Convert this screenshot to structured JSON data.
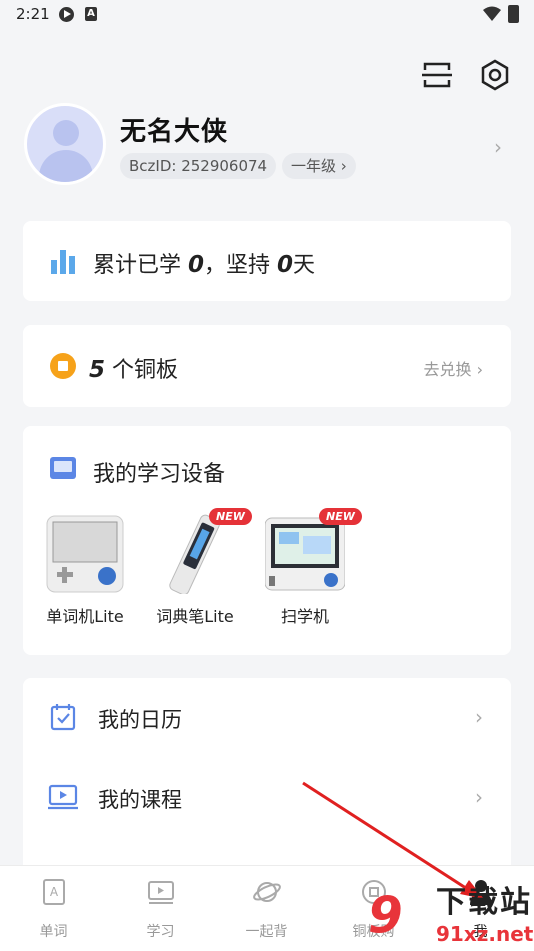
{
  "status_bar": {
    "time": "2:21",
    "icon2": "A",
    "wifi": "wifi-icon",
    "battery": "battery-icon"
  },
  "header": {
    "scan_icon": "scan-icon",
    "settings_icon": "settings-icon"
  },
  "profile": {
    "name": "无名大侠",
    "bcz_id": "BczID: 252906074",
    "grade": "一年级 ›",
    "chevron": "›"
  },
  "stats": {
    "prefix": "累计已学 ",
    "learned": "0",
    "mid": "，坚持 ",
    "days": "0",
    "suffix": "天"
  },
  "coins": {
    "count": "5",
    "unit": " 个铜板",
    "exchange": "去兑换 ›"
  },
  "devices": {
    "title": "我的学习设备",
    "items": [
      {
        "label": "单词机Lite",
        "badge": ""
      },
      {
        "label": "词典笔Lite",
        "badge": "NEW"
      },
      {
        "label": "扫学机",
        "badge": "NEW"
      }
    ]
  },
  "menu": {
    "items": [
      {
        "label": "我的日历",
        "chevron": "›"
      },
      {
        "label": "我的课程",
        "chevron": "›"
      }
    ]
  },
  "tabs": [
    {
      "label": "单词"
    },
    {
      "label": "学习"
    },
    {
      "label": "一起背"
    },
    {
      "label": "铜板购"
    },
    {
      "label": "我"
    }
  ],
  "watermark": {
    "logo": "9",
    "title": "下载站",
    "url": "91xz.net"
  },
  "colors": {
    "accent_blue": "#5b86e5",
    "coin": "#f6a21a",
    "badge": "#e53238",
    "annotation_arrow": "#e02020"
  }
}
